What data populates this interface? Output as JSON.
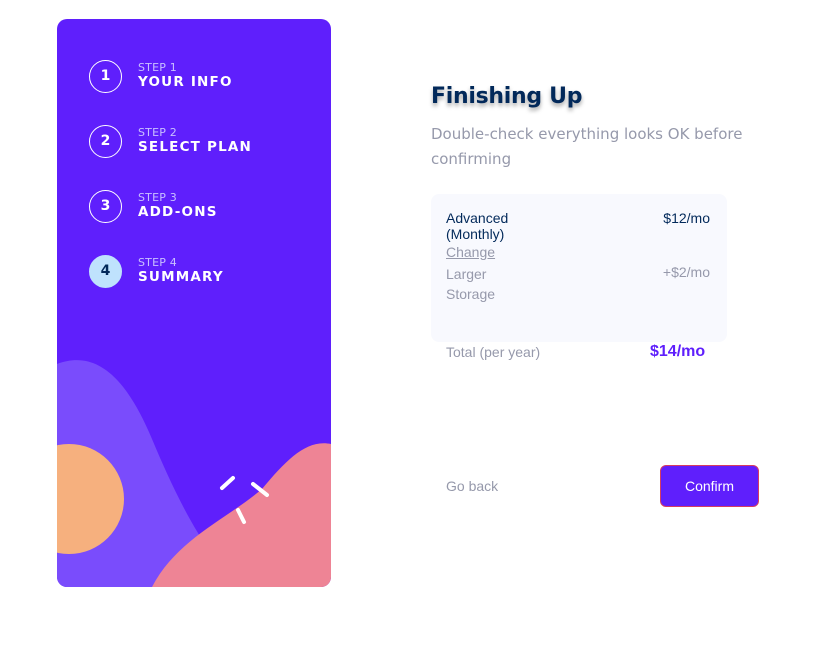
{
  "steps": [
    {
      "number": "1",
      "label": "STEP 1",
      "title": "YOUR INFO",
      "active": false
    },
    {
      "number": "2",
      "label": "STEP 2",
      "title": "SELECT PLAN",
      "active": false
    },
    {
      "number": "3",
      "label": "STEP 3",
      "title": "ADD-ONS",
      "active": false
    },
    {
      "number": "4",
      "label": "STEP 4",
      "title": "SUMMARY",
      "active": true
    }
  ],
  "header": {
    "title": "Finishing Up",
    "subtitle": "Double-check everything looks OK before confirming"
  },
  "summary": {
    "plan_name": "Advanced (Monthly)",
    "change_label": "Change",
    "plan_price": "$12/mo",
    "addons": [
      {
        "name": "Larger Storage",
        "price": "+$2/mo"
      }
    ],
    "total_label": "Total (per year)",
    "total_value": "$14/mo"
  },
  "actions": {
    "back_label": "Go back",
    "confirm_label": "Confirm"
  },
  "colors": {
    "sidebar_bg": "#5f1ffc",
    "accent": "#5f1ffc",
    "active_step": "#bfe2fd",
    "blob_orange": "#f6b07e",
    "blob_pink": "#ee8495",
    "blob_violet": "#7a4cfc",
    "heading": "#02295a",
    "muted": "#9699ab"
  }
}
